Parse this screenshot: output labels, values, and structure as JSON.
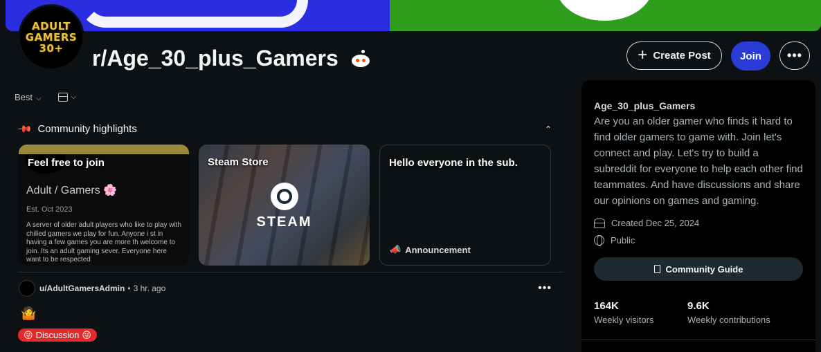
{
  "header": {
    "subreddit_title": "r/Age_30_plus_Gamers",
    "avatar_lines": [
      "ADULT",
      "GAMERS",
      "30+"
    ],
    "create_post_label": "Create Post",
    "join_label": "Join",
    "more_label": "•••"
  },
  "sortbar": {
    "sort_label": "Best"
  },
  "highlights": {
    "heading": "Community highlights",
    "cards": [
      {
        "title": "Feel free to join",
        "preview_heading": "Adult / Gamers 🌸",
        "preview_date": "Est. Oct 2023",
        "preview_body": "A server of older adult players who like to play with chilled gamers we play for fun.  Anyone i    st in having a few games you are more th    welcome to join.  Its an adult gaming sever.   Everyone here want to be respected"
      },
      {
        "title": "Steam Store",
        "preview_logo_text": "STEAM"
      },
      {
        "title": "Hello everyone in the sub.",
        "tag": "Announcement"
      }
    ]
  },
  "post": {
    "author": "u/AdultGamersAdmin",
    "separator": "•",
    "age": "3 hr. ago",
    "emoji": "🤷",
    "flair": "Discussion",
    "flair_emoji": "😜",
    "more_label": "•••"
  },
  "sidebar": {
    "name": "Age_30_plus_Gamers",
    "description": "Are you an older gamer who finds it hard to find older gamers to game with. Join let's connect and play. Let's try to build a subreddit for everyone to help each other find teammates. And have discussions and share our opinions on games and gaming.",
    "created": "Created Dec 25, 2024",
    "visibility": "Public",
    "guide_label": "Community Guide",
    "stats": [
      {
        "value": "164K",
        "label": "Weekly visitors"
      },
      {
        "value": "9.6K",
        "label": "Weekly contributions"
      }
    ]
  },
  "colors": {
    "background": "#0e1113",
    "join_button": "#2a3bd6",
    "flair": "#e32b2b",
    "banner_left": "#2b2ee0",
    "banner_right": "#2f9e1c"
  }
}
